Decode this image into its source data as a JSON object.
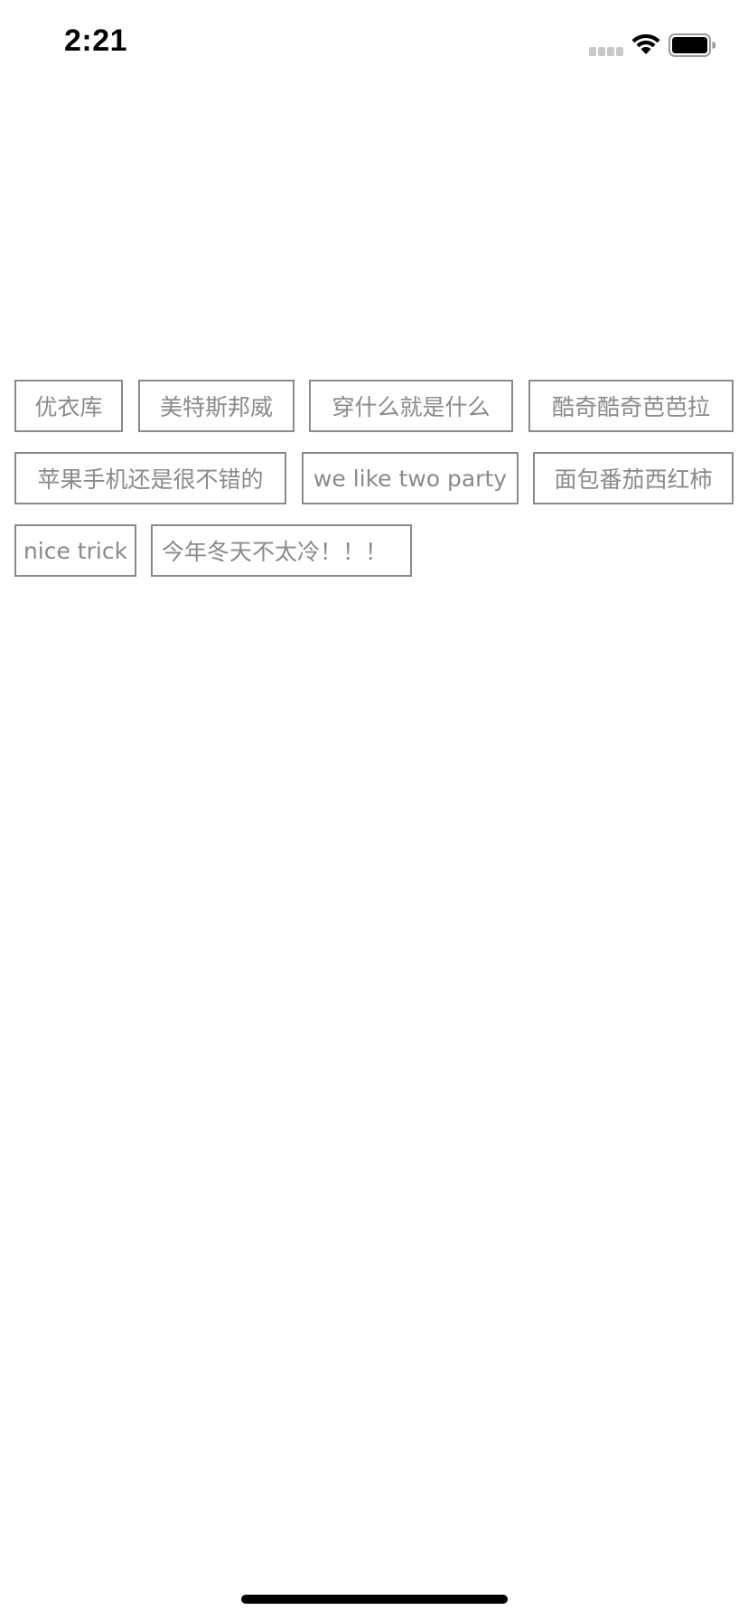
{
  "status_bar": {
    "time": "2:21"
  },
  "tags": [
    "优衣库",
    "美特斯邦威",
    "穿什么就是什么",
    "酷奇酷奇芭芭拉",
    "苹果手机还是很不错的",
    "we like two party",
    "面包番茄西红柿",
    "nice trick",
    "今年冬天不太冷！！！"
  ],
  "colors": {
    "tag_border": "#8a8a8a",
    "tag_text": "#8a8a8a",
    "background": "#ffffff"
  }
}
